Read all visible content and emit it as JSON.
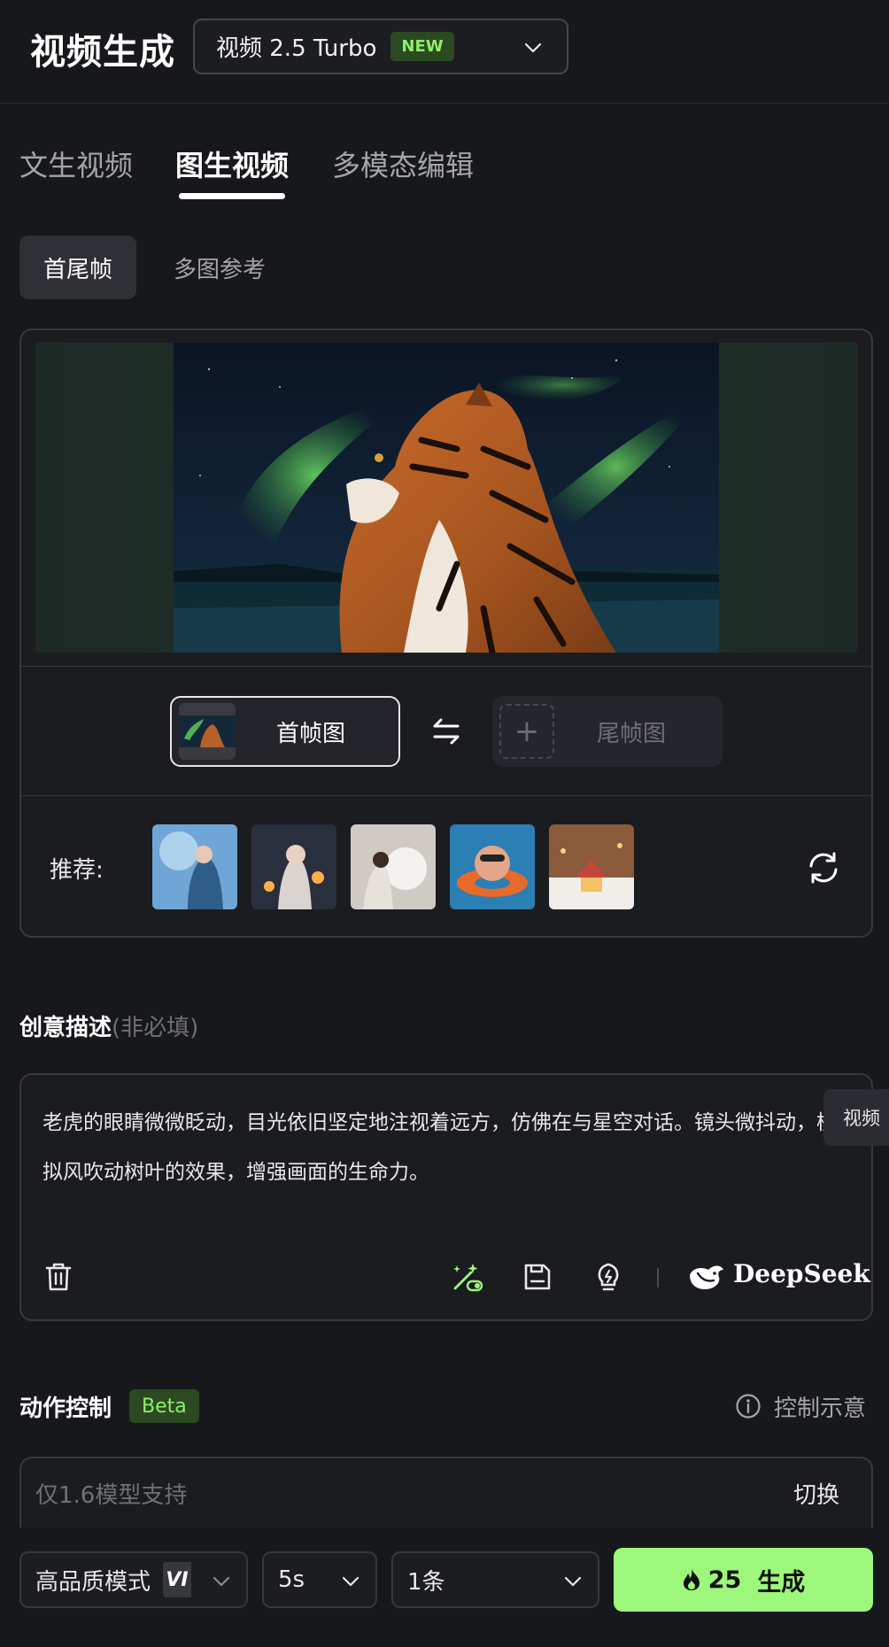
{
  "header": {
    "title": "视频生成",
    "model": {
      "name": "视频 2.5 Turbo",
      "badge": "NEW"
    }
  },
  "tabs": [
    {
      "label": "文生视频",
      "active": false
    },
    {
      "label": "图生视频",
      "active": true
    },
    {
      "label": "多模态编辑",
      "active": false
    }
  ],
  "subtabs": [
    {
      "label": "首尾帧",
      "active": true
    },
    {
      "label": "多图参考",
      "active": false
    }
  ],
  "frames": {
    "start_label": "首帧图",
    "end_label": "尾帧图",
    "plus": "+"
  },
  "recommend": {
    "label": "推荐:"
  },
  "prompt": {
    "title": "创意描述",
    "hint": "(非必填)",
    "text": "老虎的眼睛微微眨动，目光依旧坚定地注视着远方，仿佛在与星空对话。镜头微抖动，模拟风吹动树叶的效果，增强画面的生命力。",
    "side_tab": "视频",
    "deepseek": "DeepSeek"
  },
  "motion": {
    "title": "动作控制",
    "badge": "Beta",
    "info": "控制示意",
    "placeholder": "仅1.6模型支持",
    "switch": "切换"
  },
  "bottom": {
    "mode": "高品质模式",
    "vip": "VI",
    "duration": "5s",
    "count": "1条",
    "cost": "25",
    "generate": "生成"
  },
  "colors": {
    "accent": "#9cf77b",
    "background": "#17181b",
    "badge_bg": "#2b4a22",
    "badge_text": "#8ff06a"
  }
}
